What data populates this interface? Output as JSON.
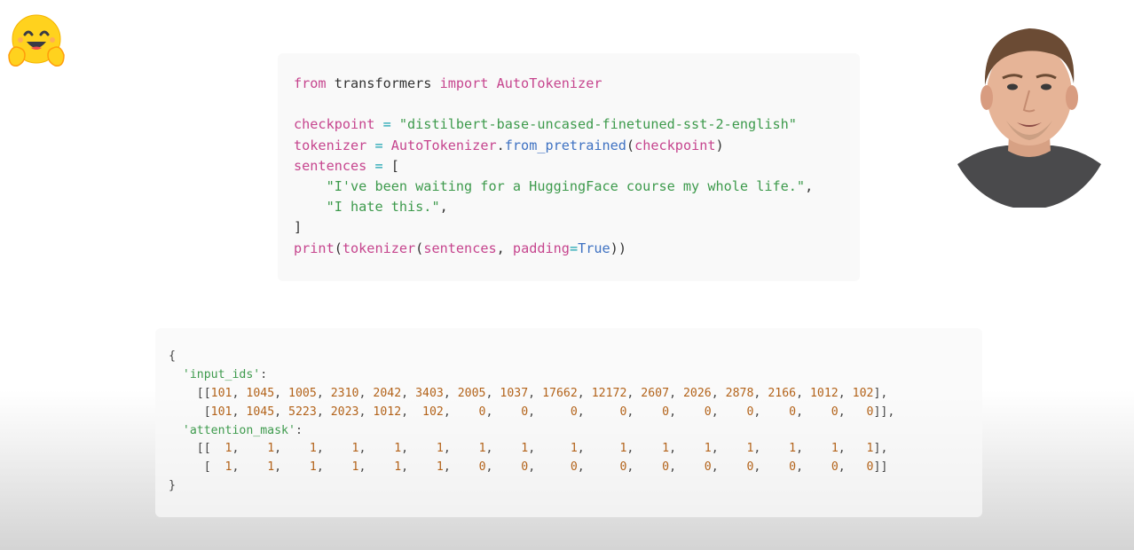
{
  "logo": {
    "icon": "hugging-face-emoji-icon"
  },
  "code": {
    "lines": [
      [
        {
          "t": "from",
          "c": "kw"
        },
        {
          "t": " transformers ",
          "c": "plain"
        },
        {
          "t": "import",
          "c": "kw"
        },
        {
          "t": " ",
          "c": "plain"
        },
        {
          "t": "AutoTokenizer",
          "c": "kw"
        }
      ],
      [],
      [
        {
          "t": "checkpoint",
          "c": "var"
        },
        {
          "t": " = ",
          "c": "op"
        },
        {
          "t": "\"distilbert-base-uncased-finetuned-sst-2-english\"",
          "c": "str"
        }
      ],
      [
        {
          "t": "tokenizer",
          "c": "var"
        },
        {
          "t": " = ",
          "c": "op"
        },
        {
          "t": "AutoTokenizer",
          "c": "kw"
        },
        {
          "t": ".",
          "c": "plain"
        },
        {
          "t": "from_pretrained",
          "c": "fn"
        },
        {
          "t": "(",
          "c": "plain"
        },
        {
          "t": "checkpoint",
          "c": "var"
        },
        {
          "t": ")",
          "c": "plain"
        }
      ],
      [
        {
          "t": "sentences",
          "c": "var"
        },
        {
          "t": " = ",
          "c": "op"
        },
        {
          "t": "[",
          "c": "plain"
        }
      ],
      [
        {
          "t": "    ",
          "c": "plain"
        },
        {
          "t": "\"I've been waiting for a HuggingFace course my whole life.\"",
          "c": "str"
        },
        {
          "t": ",",
          "c": "plain"
        }
      ],
      [
        {
          "t": "    ",
          "c": "plain"
        },
        {
          "t": "\"I hate this.\"",
          "c": "str"
        },
        {
          "t": ",",
          "c": "plain"
        }
      ],
      [
        {
          "t": "]",
          "c": "plain"
        }
      ],
      [
        {
          "t": "print",
          "c": "kw"
        },
        {
          "t": "(",
          "c": "plain"
        },
        {
          "t": "tokenizer",
          "c": "var"
        },
        {
          "t": "(",
          "c": "plain"
        },
        {
          "t": "sentences",
          "c": "var"
        },
        {
          "t": ", ",
          "c": "plain"
        },
        {
          "t": "padding",
          "c": "var"
        },
        {
          "t": "=",
          "c": "op"
        },
        {
          "t": "True",
          "c": "bool"
        },
        {
          "t": "))",
          "c": "plain"
        }
      ]
    ]
  },
  "output": {
    "open_brace": "{",
    "key1": "'input_ids'",
    "colon": ":",
    "input_ids": [
      [
        "101",
        "1045",
        "1005",
        "2310",
        "2042",
        "3403",
        "2005",
        "1037",
        "17662",
        "12172",
        "2607",
        "2026",
        "2878",
        "2166",
        "1012",
        "102"
      ],
      [
        "101",
        "1045",
        "5223",
        "2023",
        "1012",
        "102",
        "0",
        "0",
        "0",
        "0",
        "0",
        "0",
        "0",
        "0",
        "0",
        "0"
      ]
    ],
    "key2": "'attention_mask'",
    "attention_mask": [
      [
        "1",
        "1",
        "1",
        "1",
        "1",
        "1",
        "1",
        "1",
        "1",
        "1",
        "1",
        "1",
        "1",
        "1",
        "1",
        "1"
      ],
      [
        "1",
        "1",
        "1",
        "1",
        "1",
        "1",
        "0",
        "0",
        "0",
        "0",
        "0",
        "0",
        "0",
        "0",
        "0",
        "0"
      ]
    ],
    "close_brace": "}"
  },
  "speaker": {
    "label": "presenter-webcam"
  }
}
